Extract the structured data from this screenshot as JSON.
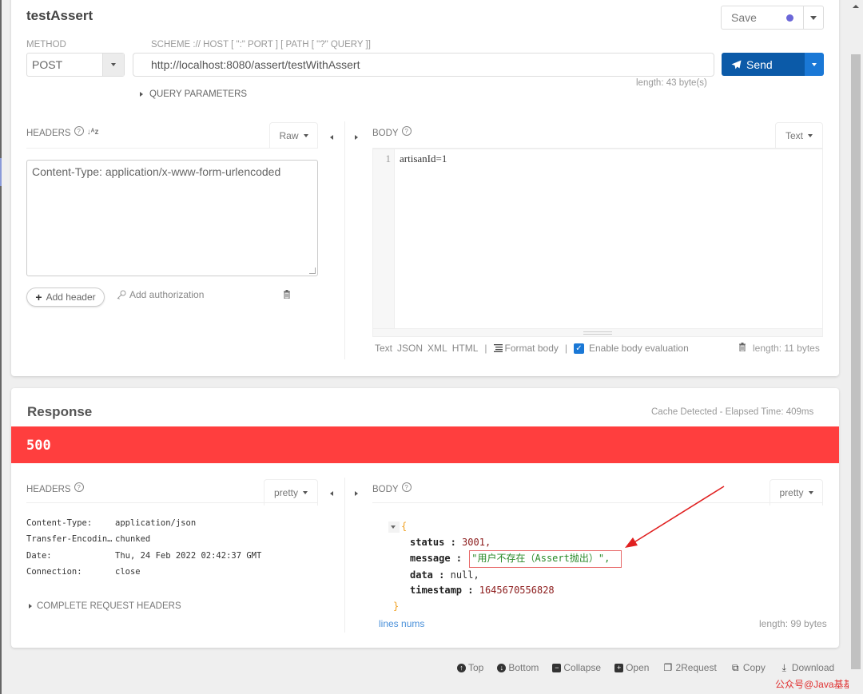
{
  "request": {
    "title": "testAssert",
    "save": {
      "label": "Save",
      "dot_color": "#6b67d8"
    },
    "method": {
      "label": "METHOD",
      "value": "POST"
    },
    "url": {
      "label": "SCHEME :// HOST [ \":\" PORT ] [ PATH [ \"?\" QUERY ]]",
      "value": "http://localhost:8080/assert/testWithAssert",
      "length": "length: 43 byte(s)"
    },
    "send": {
      "label": "Send",
      "color": "#0b5aa8"
    },
    "query_parameters": "QUERY PARAMETERS",
    "headers": {
      "label": "HEADERS",
      "mode": "Raw",
      "value": "Content-Type: application/x-www-form-urlencoded",
      "add_header": "Add header",
      "add_authorization": "Add authorization"
    },
    "body": {
      "label": "BODY",
      "mode": "Text",
      "lines": [
        {
          "num": "1",
          "text": "artisanId=1"
        }
      ],
      "formats": [
        "Text",
        "JSON",
        "XML",
        "HTML"
      ],
      "format_body": "Format body",
      "enable_evaluation": "Enable body evaluation",
      "enable_evaluation_checked": true,
      "length": "length: 11 bytes"
    }
  },
  "response": {
    "title": "Response",
    "elapsed": "Cache Detected - Elapsed Time: 409ms",
    "status_code": "500",
    "status_color": "#ff3e3e",
    "headers": {
      "label": "HEADERS",
      "mode": "pretty",
      "rows": [
        {
          "key": "Content-Type:",
          "value": "application/json"
        },
        {
          "key": "Transfer-Encodin…",
          "value": "chunked"
        },
        {
          "key": "Date:",
          "value": "Thu, 24 Feb 2022 02:42:37 GMT"
        },
        {
          "key": "Connection:",
          "value": "close"
        }
      ],
      "complete_request_headers": "COMPLETE REQUEST HEADERS"
    },
    "body": {
      "label": "BODY",
      "mode": "pretty",
      "open_brace": "{",
      "close_brace": "}",
      "fields": [
        {
          "key": "status",
          "value": "3001,"
        },
        {
          "key": "message",
          "value": "\"用户不存在（Assert抛出）\","
        },
        {
          "key": "data",
          "value": "null,"
        },
        {
          "key": "timestamp",
          "value": "1645670556828"
        }
      ],
      "lines_nums": "lines nums",
      "length": "length: 99 bytes"
    }
  },
  "bottom_toolbar": [
    {
      "icon": "arrow-up-circle-icon",
      "label": "Top"
    },
    {
      "icon": "arrow-down-circle-icon",
      "label": "Bottom"
    },
    {
      "icon": "minus-square-icon",
      "label": "Collapse"
    },
    {
      "icon": "plus-square-icon",
      "label": "Open"
    },
    {
      "icon": "paste-icon",
      "label": "2Request"
    },
    {
      "icon": "copy-icon",
      "label": "Copy"
    },
    {
      "icon": "download-icon",
      "label": "Download"
    }
  ],
  "watermark": "公众号@Java基基"
}
